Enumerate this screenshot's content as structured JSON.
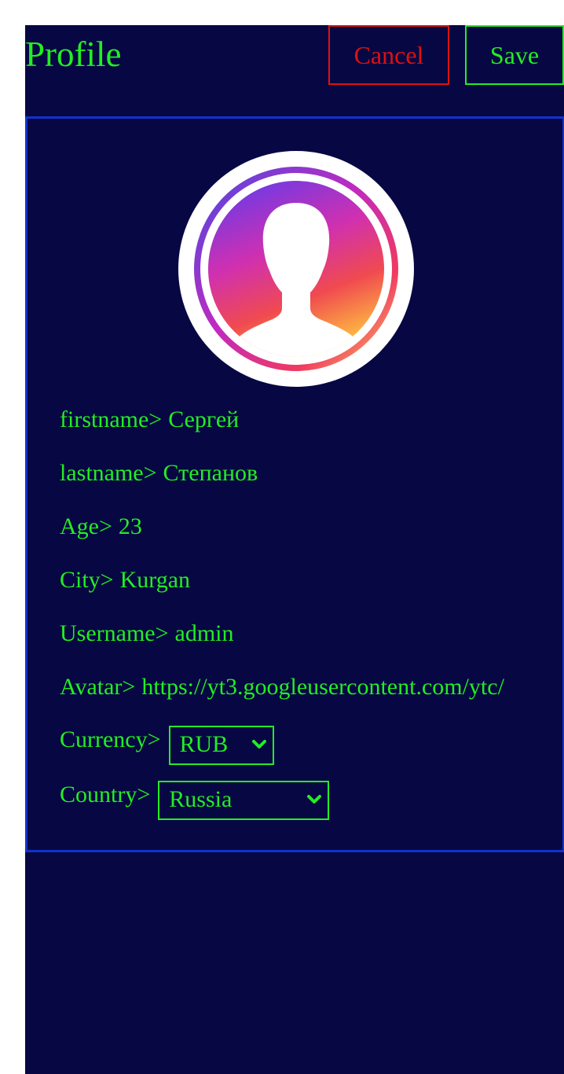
{
  "header": {
    "title": "Profile",
    "cancel_label": "Cancel",
    "save_label": "Save"
  },
  "profile": {
    "fields": [
      {
        "label": "firstname>",
        "value": "Сергей"
      },
      {
        "label": "lastname>",
        "value": "Степанов"
      },
      {
        "label": "Age>",
        "value": "23"
      },
      {
        "label": "City>",
        "value": "Kurgan"
      },
      {
        "label": "Username>",
        "value": "admin"
      },
      {
        "label": "Avatar>",
        "value": "https://yt3.googleusercontent.com/ytc/"
      }
    ],
    "currency": {
      "label": "Currency>",
      "selected": "RUB"
    },
    "country": {
      "label": "Country>",
      "selected": "Russia"
    }
  },
  "colors": {
    "background": "#070743",
    "text": "#22ee22",
    "cancel": "#dd1111",
    "card_border": "#1133cc"
  },
  "icons": {
    "avatar": "user-silhouette-icon",
    "dropdown": "chevron-down-icon"
  }
}
